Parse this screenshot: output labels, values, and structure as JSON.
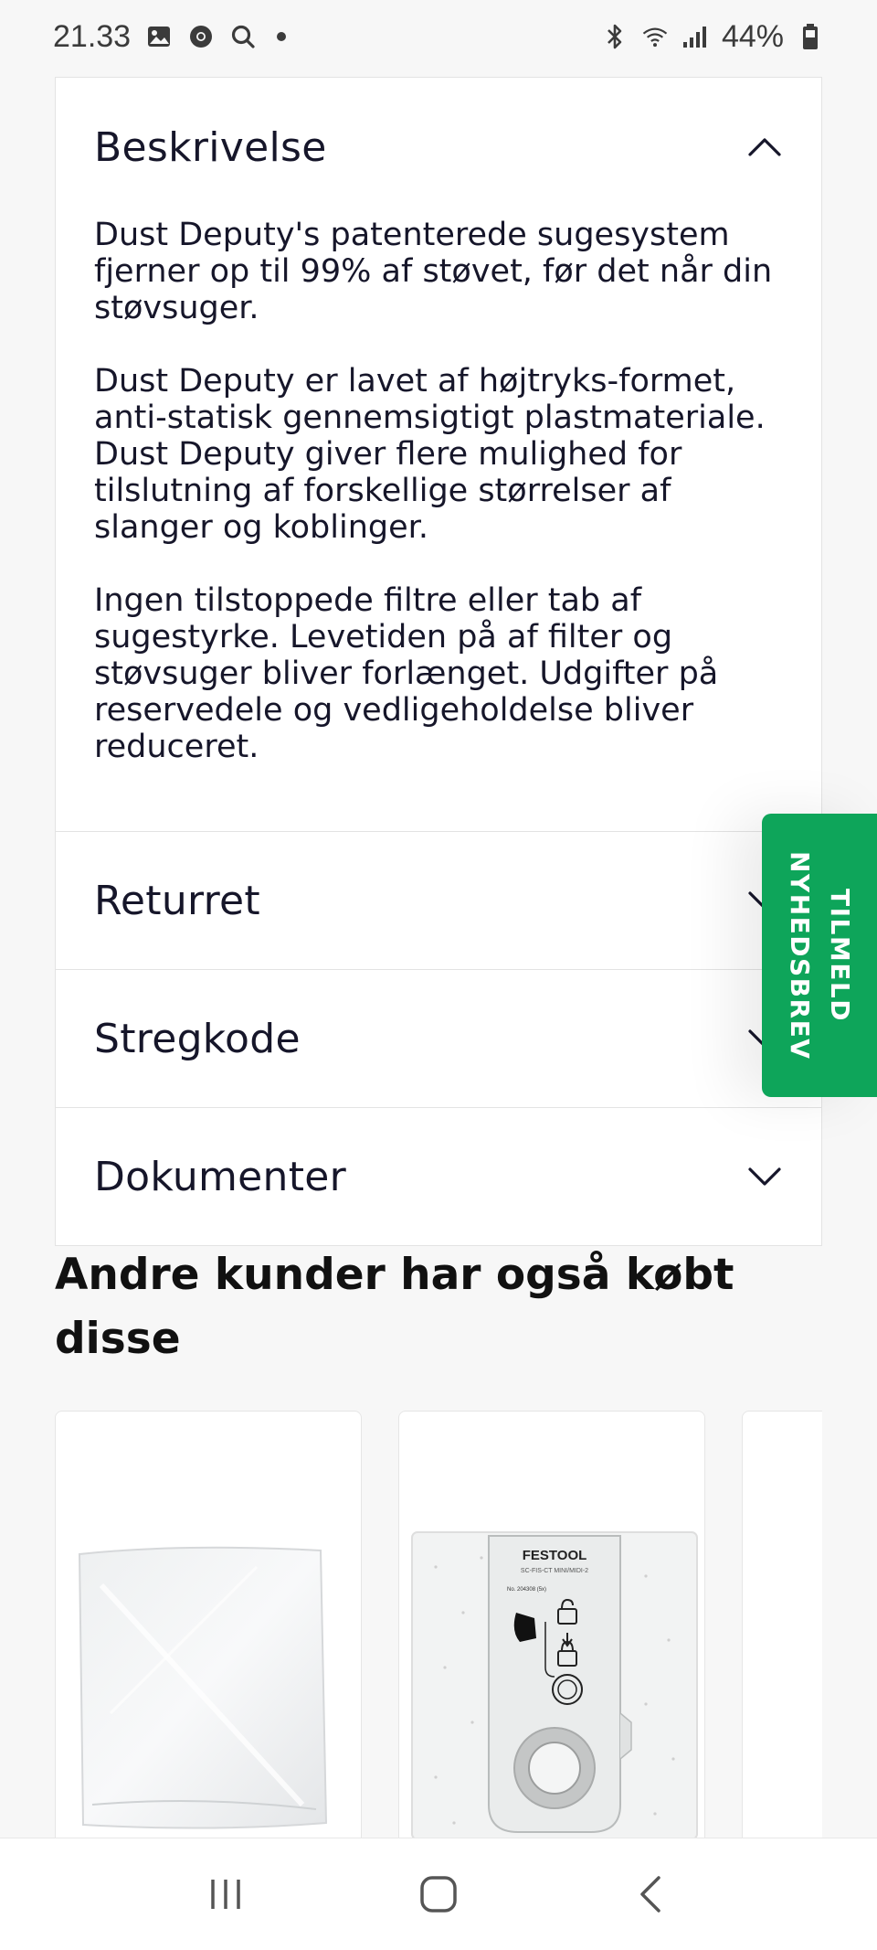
{
  "status_bar": {
    "time": "21.33",
    "battery": "44%"
  },
  "accordion": {
    "sections": [
      {
        "title": "Beskrivelse",
        "expanded": true,
        "paragraphs": [
          "Dust Deputy's patenterede sugesystem fjerner op til 99% af støvet, før det når din støvsuger.",
          "Dust Deputy er lavet af højtryks-formet, anti-statisk gennemsigtigt plastmateriale. Dust Deputy giver flere mulighed for tilslutning af forskellige størrelser af slanger og koblinger.",
          "Ingen tilstoppede filtre eller tab af sugestyrke. Levetiden på af filter og støvsuger bliver forlænget. Udgifter på reservedele og vedligeholdelse bliver reduceret."
        ]
      },
      {
        "title": "Returret",
        "expanded": false
      },
      {
        "title": "Stregkode",
        "expanded": false
      },
      {
        "title": "Dokumenter",
        "expanded": false
      }
    ]
  },
  "newsletter_tab": {
    "line1": "TILMELD",
    "line2": "NYHEDSBREV",
    "color": "#0ea55a"
  },
  "related": {
    "title": "Andre kunder har også købt disse",
    "products": [
      {
        "image": "plastic-bag"
      },
      {
        "image": "filter-bag",
        "brand": "FESTOOL",
        "model": "SC-FIS-CT MINI/MIDI-2",
        "item_no": "No. 204308 (5x)"
      },
      {
        "image": "partial"
      }
    ]
  },
  "icons": {
    "chevron_up": "chevron-up-icon",
    "chevron_down": "chevron-down-icon"
  }
}
